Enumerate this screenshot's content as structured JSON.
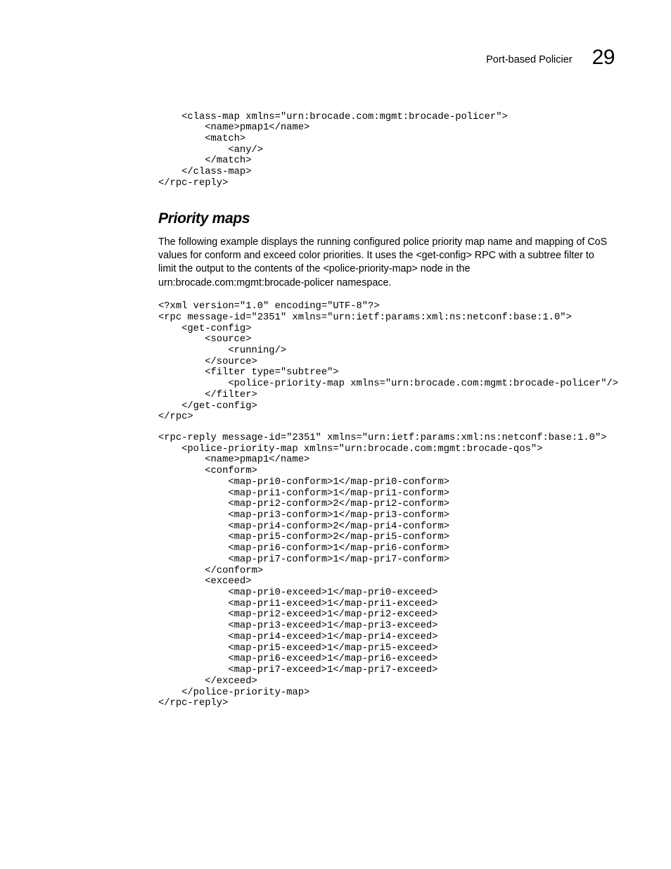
{
  "header": {
    "title": "Port-based Policier",
    "chapter_number": "29"
  },
  "code_block_top": "    <class-map xmlns=\"urn:brocade.com:mgmt:brocade-policer\">\n        <name>pmap1</name>\n        <match>\n            <any/>\n        </match>\n    </class-map>\n</rpc-reply>",
  "section_heading": "Priority maps",
  "body_paragraph": "The following example displays the running configured police priority map name and mapping of CoS values for conform and exceed color priorities. It uses the <get-config> RPC with a subtree filter to limit the output to the contents of the <police-priority-map> node in the urn:brocade.com:mgmt:brocade-policer namespace.",
  "code_block_request": "<?xml version=\"1.0\" encoding=\"UTF-8\"?>\n<rpc message-id=\"2351\" xmlns=\"urn:ietf:params:xml:ns:netconf:base:1.0\">\n    <get-config>\n        <source>\n            <running/>\n        </source>\n        <filter type=\"subtree\">\n            <police-priority-map xmlns=\"urn:brocade.com:mgmt:brocade-policer\"/>\n        </filter>\n    </get-config>\n</rpc>",
  "code_block_reply": "<rpc-reply message-id=\"2351\" xmlns=\"urn:ietf:params:xml:ns:netconf:base:1.0\">\n    <police-priority-map xmlns=\"urn:brocade.com:mgmt:brocade-qos\">\n        <name>pmap1</name>\n        <conform>\n            <map-pri0-conform>1</map-pri0-conform>\n            <map-pri1-conform>1</map-pri1-conform>\n            <map-pri2-conform>2</map-pri2-conform>\n            <map-pri3-conform>1</map-pri3-conform>\n            <map-pri4-conform>2</map-pri4-conform>\n            <map-pri5-conform>2</map-pri5-conform>\n            <map-pri6-conform>1</map-pri6-conform>\n            <map-pri7-conform>1</map-pri7-conform>\n        </conform>\n        <exceed>\n            <map-pri0-exceed>1</map-pri0-exceed>\n            <map-pri1-exceed>1</map-pri1-exceed>\n            <map-pri2-exceed>1</map-pri2-exceed>\n            <map-pri3-exceed>1</map-pri3-exceed>\n            <map-pri4-exceed>1</map-pri4-exceed>\n            <map-pri5-exceed>1</map-pri5-exceed>\n            <map-pri6-exceed>1</map-pri6-exceed>\n            <map-pri7-exceed>1</map-pri7-exceed>\n        </exceed>\n    </police-priority-map>\n</rpc-reply>"
}
